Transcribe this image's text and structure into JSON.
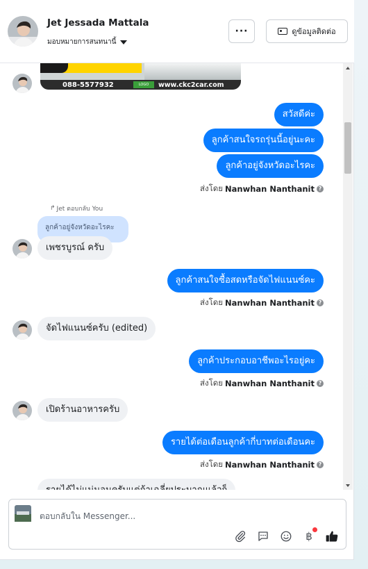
{
  "header": {
    "contact_name": "Jet Jessada Mattala",
    "assign_label": "มอบหมายการสนทนานี้",
    "more_label": "···",
    "contact_info_label": "ดูข้อมูลติดต่อ"
  },
  "ad_image": {
    "phone": "088-5577932",
    "url": "www.ckc2car.com"
  },
  "messages": [
    {
      "dir": "out",
      "text": "สวัสดีค่ะ"
    },
    {
      "dir": "out",
      "text": "ลูกค้าสนใจรถรุ่นนี้อยู่นะคะ"
    },
    {
      "dir": "out",
      "text": "ลูกค้าอยู่จังหวัดอะไรคะ"
    },
    {
      "dir": "in",
      "text": "เพชรบูรณ์ ครับ"
    },
    {
      "dir": "out",
      "text": "ลูกค้าสนใจซื้อสดหรือจัดไฟแนนซ์คะ"
    },
    {
      "dir": "in",
      "text": "จัดไฟแนนซ์ครับ (edited)"
    },
    {
      "dir": "out",
      "text": "ลูกค้าประกอบอาชีพอะไรอยู่คะ"
    },
    {
      "dir": "in",
      "text": "เปิดร้านอาหารครับ"
    },
    {
      "dir": "out",
      "text": "รายได้ต่อเดือนลูกค้ากี่บาทต่อเดือนคะ"
    },
    {
      "dir": "in",
      "text": "รายได้ไม่แน่นอนครับแต่ถ้าเฉลี่ยประมาณแล้วก็"
    }
  ],
  "sent_by": {
    "prefix": "ส่งโดย",
    "name": "Nanwhan Nanthanit"
  },
  "reply": {
    "hint": "Jet ตอบกลับ You",
    "quoted_text": "ลูกค้าอยู่จังหวัดอะไรคะ"
  },
  "composer": {
    "placeholder": "ตอบกลับใน Messenger..."
  },
  "colors": {
    "outgoing_bubble": "#0a7cff",
    "incoming_bubble": "#eff1f4",
    "quoted_bubble": "#d0e3ff",
    "notification_dot": "#fa383e"
  },
  "icons": [
    "more-icon",
    "contact-card-icon",
    "chevron-down-icon",
    "info-icon",
    "attach-icon",
    "saved-reply-icon",
    "emoji-icon",
    "payment-icon",
    "like-icon"
  ]
}
